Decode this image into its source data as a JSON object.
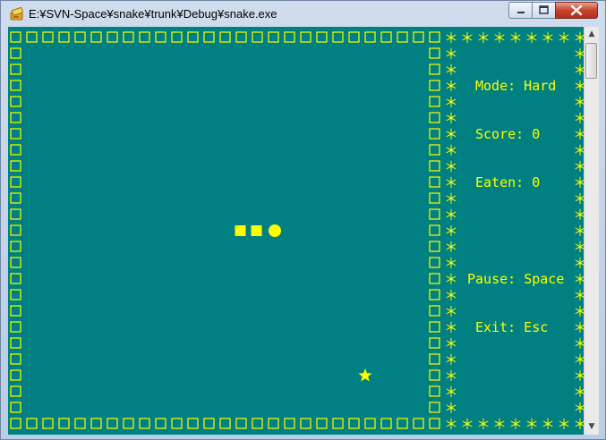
{
  "window": {
    "title": "E:¥SVN-Space¥snake¥trunk¥Debug¥snake.exe",
    "app_icon": "console-app-icon",
    "controls": {
      "minimize": "minimize-icon",
      "maximize": "maximize-icon",
      "close": "close-icon"
    }
  },
  "game": {
    "background": "#008080",
    "foreground": "#ffff00",
    "symbols": {
      "wall": "□",
      "panel_border": "＊",
      "snake_body": "■",
      "snake_head": "●",
      "food": "★"
    },
    "snake": {
      "length": 3,
      "direction": "right"
    },
    "panel": {
      "mode": "Mode: Hard",
      "score": "Score: 0",
      "eaten": "Eaten: 0",
      "pause": "Pause: Space",
      "exit": "Exit: Esc"
    }
  }
}
